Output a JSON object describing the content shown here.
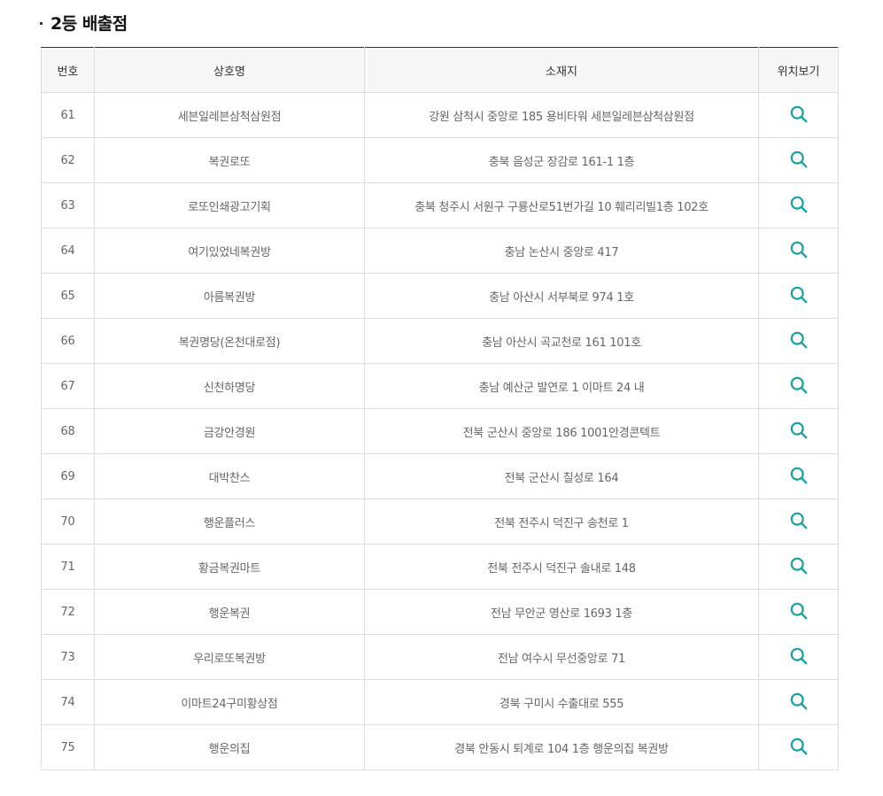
{
  "section": {
    "title": "2등 배출점"
  },
  "table": {
    "headers": {
      "number": "번호",
      "name": "상호명",
      "address": "소재지",
      "location": "위치보기"
    },
    "rows": [
      {
        "number": "61",
        "name": "세븐일레븐삼척삼원점",
        "address": "강원 삼척시 중앙로 185 용비타워 세븐일레븐삼척삼원점"
      },
      {
        "number": "62",
        "name": "복권로또",
        "address": "충북 음성군 장감로 161-1 1층"
      },
      {
        "number": "63",
        "name": "로또인쇄광고기획",
        "address": "충북 청주시 서원구 구룡산로51번가길 10 훼리리빌1층 102호"
      },
      {
        "number": "64",
        "name": "여기있었네복권방",
        "address": "충남 논산시 중앙로 417"
      },
      {
        "number": "65",
        "name": "아름복권방",
        "address": "충남 아산시 서부북로 974 1호"
      },
      {
        "number": "66",
        "name": "복권명당(온천대로점)",
        "address": "충남 아산시 곡교천로 161 101호"
      },
      {
        "number": "67",
        "name": "신천하명당",
        "address": "충남 예산군 발연로 1 이마트 24 내"
      },
      {
        "number": "68",
        "name": "금강안경원",
        "address": "전북 군산시 중앙로 186 1001안경콘텍트"
      },
      {
        "number": "69",
        "name": "대박찬스",
        "address": "전북 군산시 칠성로 164"
      },
      {
        "number": "70",
        "name": "행운플러스",
        "address": "전북 전주시 덕진구 송천로 1"
      },
      {
        "number": "71",
        "name": "황금복권마트",
        "address": "전북 전주시 덕진구 솔내로 148"
      },
      {
        "number": "72",
        "name": "행운복권",
        "address": "전남 무안군 영산로 1693 1층"
      },
      {
        "number": "73",
        "name": "우리로또복권방",
        "address": "전남 여수시 무선중앙로 71"
      },
      {
        "number": "74",
        "name": "이마트24구미황상점",
        "address": "경북 구미시 수출대로 555"
      },
      {
        "number": "75",
        "name": "행운의집",
        "address": "경북 안동시 퇴계로 104 1층 행운의집 복권방"
      }
    ]
  },
  "icon": {
    "name": "search-icon",
    "color": "#17a2a0"
  }
}
